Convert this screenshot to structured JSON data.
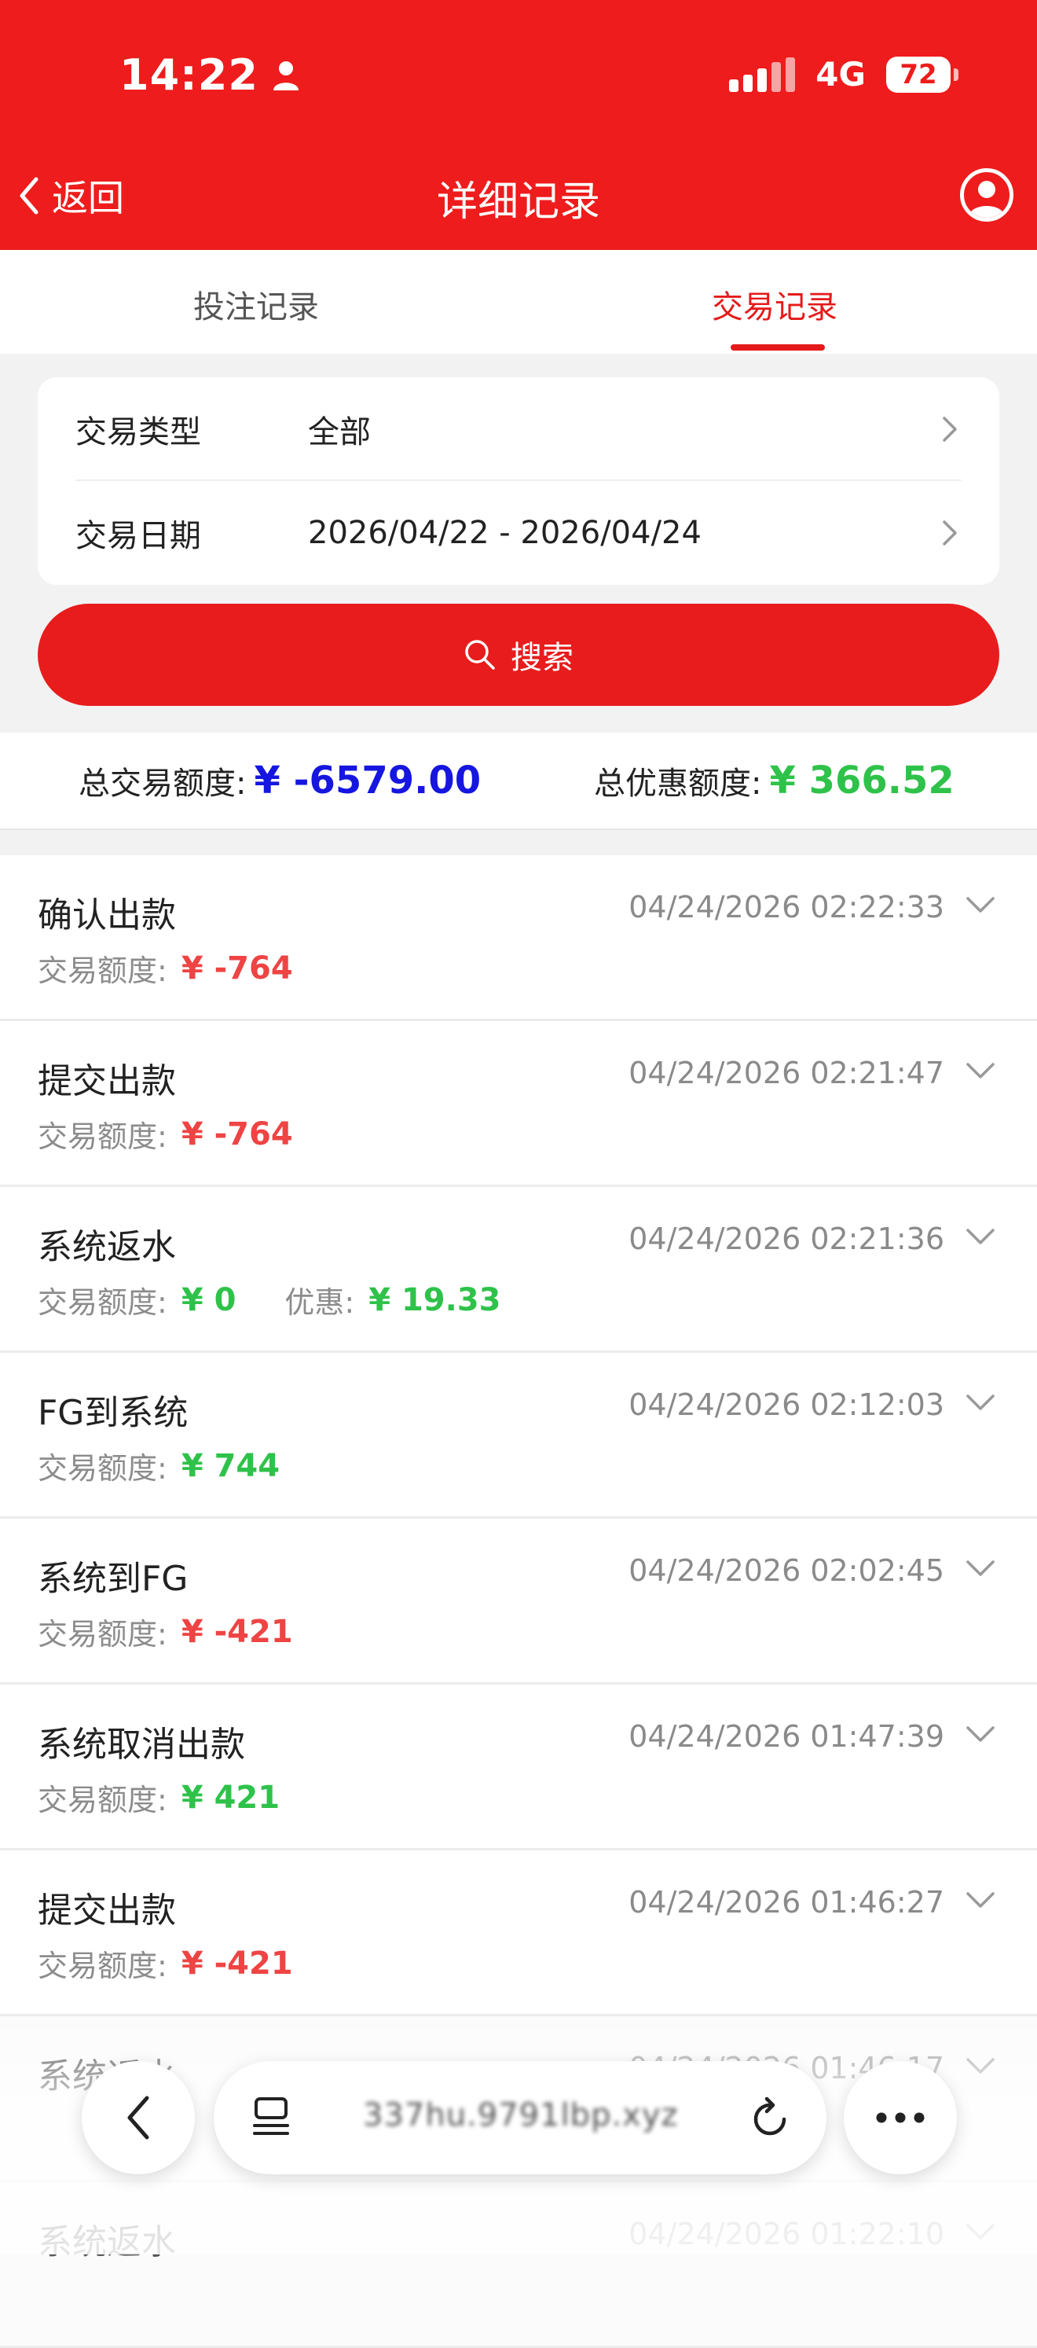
{
  "status_bar": {
    "time": "14:22",
    "network": "4G",
    "battery": "72"
  },
  "nav": {
    "back_label": "返回",
    "title": "详细记录"
  },
  "tabs": [
    {
      "label": "投注记录",
      "active": false
    },
    {
      "label": "交易记录",
      "active": true
    }
  ],
  "filters": {
    "type_label": "交易类型",
    "type_value": "全部",
    "date_label": "交易日期",
    "date_value": "2026/04/22 - 2026/04/24"
  },
  "search_label": "搜索",
  "summary": {
    "total_label": "总交易额度:",
    "total_value": "¥ -6579.00",
    "discount_label": "总优惠额度:",
    "discount_value": "¥ 366.52"
  },
  "amount_label": "交易额度:",
  "discount_label": "优惠:",
  "records": [
    {
      "title": "确认出款",
      "time": "04/24/2026 02:22:33",
      "amount": "¥ -764",
      "sign": "neg"
    },
    {
      "title": "提交出款",
      "time": "04/24/2026 02:21:47",
      "amount": "¥ -764",
      "sign": "neg"
    },
    {
      "title": "系统返水",
      "time": "04/24/2026 02:21:36",
      "amount": "¥ 0",
      "sign": "pos",
      "discount": "¥ 19.33"
    },
    {
      "title": "FG到系统",
      "time": "04/24/2026 02:12:03",
      "amount": "¥ 744",
      "sign": "pos"
    },
    {
      "title": "系统到FG",
      "time": "04/24/2026 02:02:45",
      "amount": "¥ -421",
      "sign": "neg"
    },
    {
      "title": "系统取消出款",
      "time": "04/24/2026 01:47:39",
      "amount": "¥ 421",
      "sign": "pos"
    },
    {
      "title": "提交出款",
      "time": "04/24/2026 01:46:27",
      "amount": "¥ -421",
      "sign": "neg"
    },
    {
      "title": "系统返水",
      "time": "04/24/2026 01:46:17",
      "amount": "",
      "sign": "pos"
    },
    {
      "title": "系统返水",
      "time": "04/24/2026 01:22:10",
      "amount": "",
      "sign": "pos"
    }
  ],
  "browser": {
    "url": "337hu.9791lbp.xyz"
  }
}
